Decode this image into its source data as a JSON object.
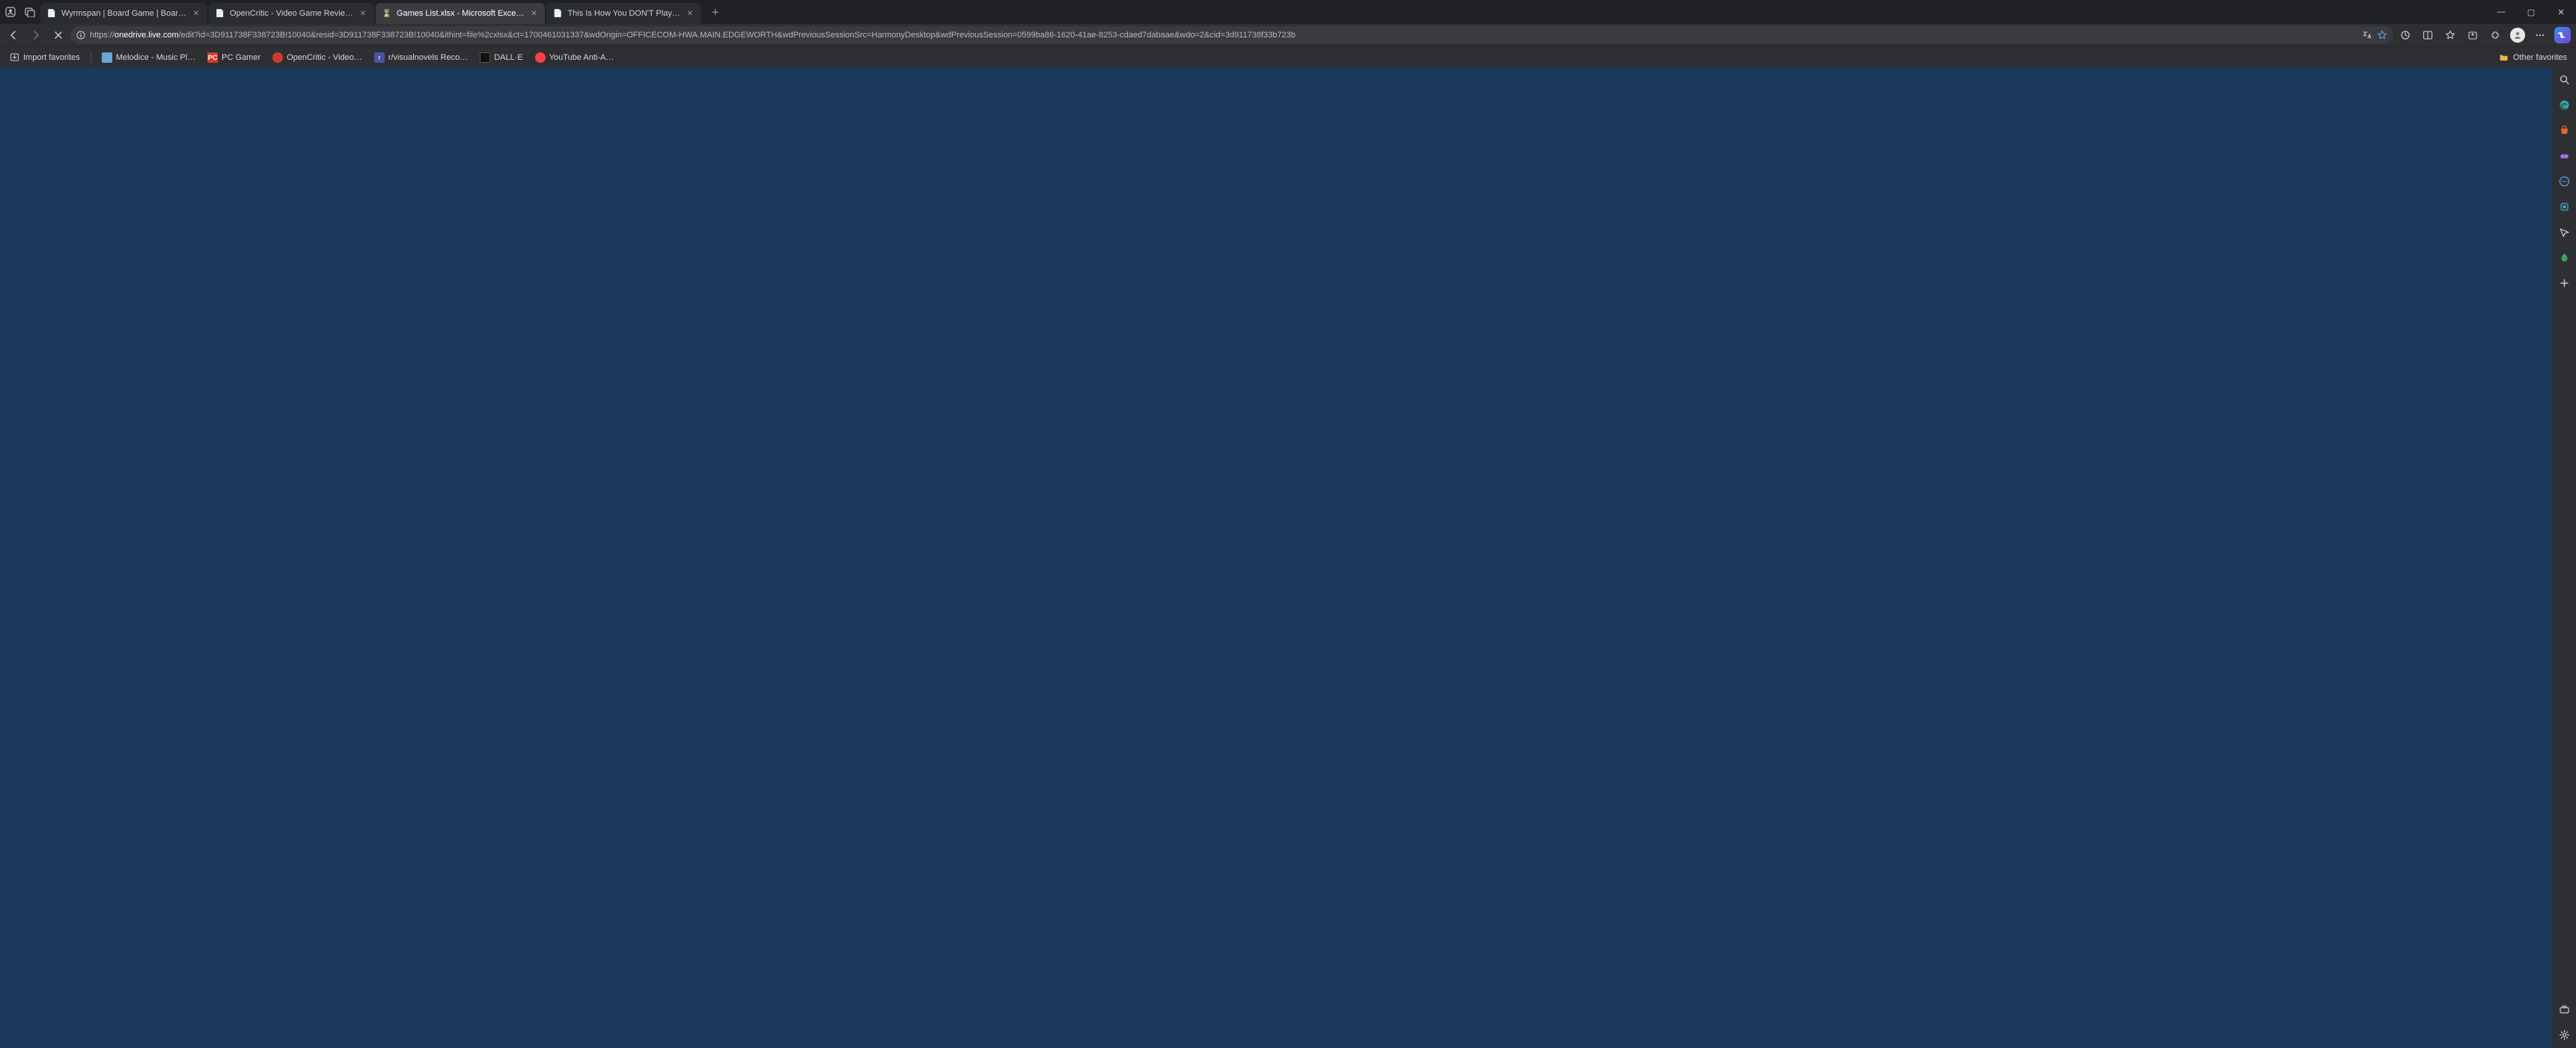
{
  "tabs": [
    {
      "title": "Wyrmspan | Board Game | Boar…",
      "favicon": "📄",
      "active": false
    },
    {
      "title": "OpenCritic - Video Game Revie…",
      "favicon": "📄",
      "active": false
    },
    {
      "title": "Games List.xlsx - Microsoft Exce…",
      "favicon": "⌛",
      "active": true
    },
    {
      "title": "This Is How You DON'T Play…",
      "favicon": "📄",
      "active": false
    }
  ],
  "window_controls": {
    "min": "—",
    "max": "▢",
    "close": "✕"
  },
  "toolbar": {
    "url_host": "onedrive.live.com",
    "url_path": "/edit?id=3D911738F338723B!10040&resid=3D911738F338723B!10040&ithint=file%2cxlsx&ct=1700461031337&wdOrigin=OFFICECOM-HWA.MAIN.EDGEWORTH&wdPreviousSessionSrc=HarmonyDesktop&wdPreviousSession=0599ba86-1620-41ae-8253-cdaed7dabaae&wdo=2&cid=3d911738f33b723b",
    "url_scheme": "https://"
  },
  "bookmarks": {
    "import_label": "Import favorites",
    "items": [
      {
        "label": "Melodice - Music Pl…",
        "icon_bg": "#6aa6d8",
        "icon_fg": "#fff",
        "icon_txt": ""
      },
      {
        "label": "PC Gamer",
        "icon_bg": "#d23a2f",
        "icon_fg": "#fff",
        "icon_txt": "PC"
      },
      {
        "label": "OpenCritic - Video…",
        "icon_bg": "#d23a2f",
        "icon_fg": "#fff",
        "icon_txt": ""
      },
      {
        "label": "r/visualnovels Reco…",
        "icon_bg": "#4b50a6",
        "icon_fg": "#fff",
        "icon_txt": "r"
      },
      {
        "label": "DALL·E",
        "icon_bg": "#111",
        "icon_fg": "#fff",
        "icon_txt": ""
      },
      {
        "label": "YouTube Anti-A…",
        "icon_bg": "#ff4040",
        "icon_fg": "#fff",
        "icon_txt": ""
      }
    ],
    "other_label": "Other favorites"
  },
  "rightbar_icons": [
    "search-icon",
    "edge-icon",
    "shopping-icon",
    "games-icon",
    "chat-icon",
    "tools-icon",
    "send-icon",
    "performance-icon",
    "add-icon"
  ],
  "rightbar_bottom": [
    "toolbox-icon",
    "settings-icon"
  ]
}
